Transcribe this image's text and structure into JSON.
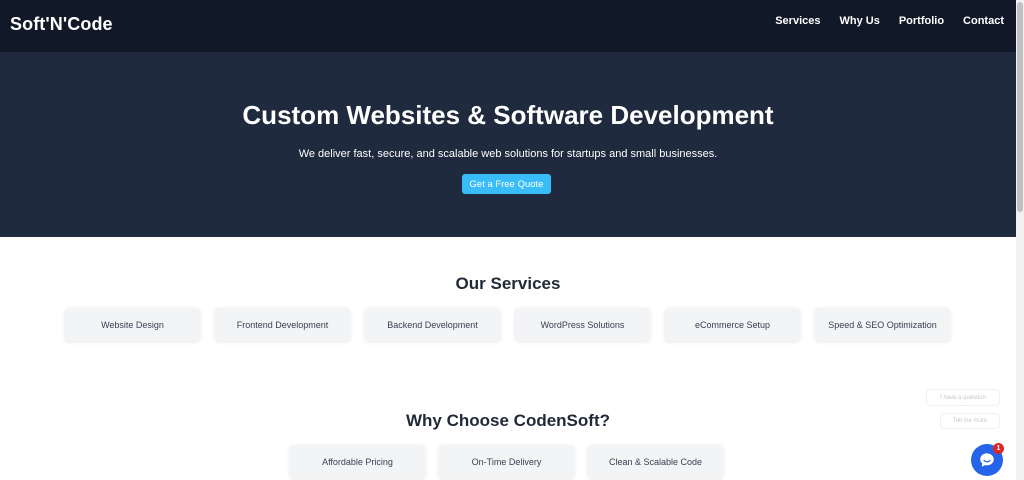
{
  "header": {
    "logo": "Soft'N'Code",
    "nav": [
      "Services",
      "Why Us",
      "Portfolio",
      "Contact"
    ]
  },
  "hero": {
    "title": "Custom Websites & Software Development",
    "subtitle": "We deliver fast, secure, and scalable web solutions for startups and small businesses.",
    "cta": "Get a Free Quote"
  },
  "services": {
    "title": "Our Services",
    "items": [
      "Website Design",
      "Frontend Development",
      "Backend Development",
      "WordPress Solutions",
      "eCommerce Setup",
      "Speed & SEO Optimization"
    ]
  },
  "why": {
    "title": "Why Choose CodenSoft?",
    "items": [
      "Affordable Pricing",
      "On-Time Delivery",
      "Clean & Scalable Code"
    ]
  },
  "chat": {
    "bubbles": [
      "I have a question",
      "Tell me more"
    ],
    "badge": "1",
    "icon": "chat-icon"
  },
  "colors": {
    "header_bg": "#111827",
    "hero_bg": "#1f2a3e",
    "accent": "#38bdf8",
    "chat": "#2563eb"
  }
}
